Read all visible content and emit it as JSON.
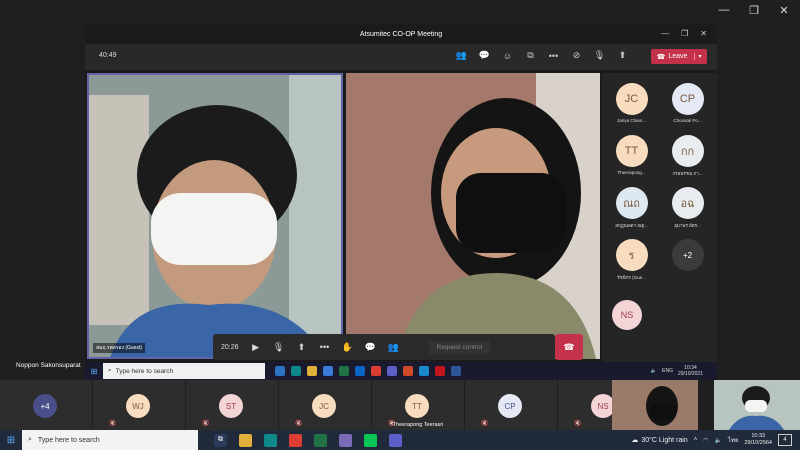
{
  "remote": {
    "window_title": "Atsumitec CO-OP Meeting",
    "meeting_time": "40:49",
    "leave_label": "Leave",
    "video1_name": "สมฤ.รพลรอง (Guest)",
    "call_time": "20:26",
    "request_control": "Request control",
    "roster": [
      {
        "initials": "JC",
        "name": "Jariya Chian...",
        "color": "#f7dcc0"
      },
      {
        "initials": "CP",
        "name": "Choosak Po...",
        "color": "#e5e8f5"
      },
      {
        "initials": "TT",
        "name": "Theerapong...",
        "color": "#f7dcc0"
      },
      {
        "initials": "กก",
        "name": "กรธพรรณ กา...",
        "color": "#e8ecf0"
      },
      {
        "initials": "ณถ",
        "name": "สฤฎณลดา ณฐ...",
        "color": "#dde8f0"
      },
      {
        "initials": "อฉ",
        "name": "อุมาพร อัตร...",
        "color": "#e8ecf0"
      },
      {
        "initials": "ร",
        "name": "รัชนีกร (Gue...",
        "color": "#f7dcc0"
      },
      {
        "initials": "+2",
        "name": "",
        "color": "#3b3b3b"
      }
    ],
    "ns_initials": "NS",
    "taskbar": {
      "search_placeholder": "Type here to search",
      "lang": "ENG",
      "time": "10:34",
      "date": "29/10/2021"
    }
  },
  "presenter_name": "Noppon Sakonsuparat",
  "strip": [
    {
      "initials": "+4",
      "color": "#4a4f8a",
      "text_color": "#fff",
      "name": ""
    },
    {
      "initials": "WJ",
      "color": "#f7dcc0",
      "text_color": "#7a5a3a",
      "name": ""
    },
    {
      "initials": "ST",
      "color": "#f3d4d7",
      "text_color": "#9a3a4a",
      "name": ""
    },
    {
      "initials": "JC",
      "color": "#f7dcc0",
      "text_color": "#7a5a3a",
      "name": ""
    },
    {
      "initials": "TT",
      "color": "#f7dcc0",
      "text_color": "#7a5a3a",
      "name": "Theerapong Teerasri"
    },
    {
      "initials": "CP",
      "color": "#e5e8f5",
      "text_color": "#4a4f8a",
      "name": ""
    },
    {
      "initials": "NS",
      "color": "#f3d4d7",
      "text_color": "#9a3a4a",
      "name": ""
    }
  ],
  "local_taskbar": {
    "search_placeholder": "Type here to search",
    "weather": "30°C  Light rain",
    "lang": "ไทย",
    "time": "10:33",
    "date": "29/10/2564",
    "notifications": "4"
  }
}
